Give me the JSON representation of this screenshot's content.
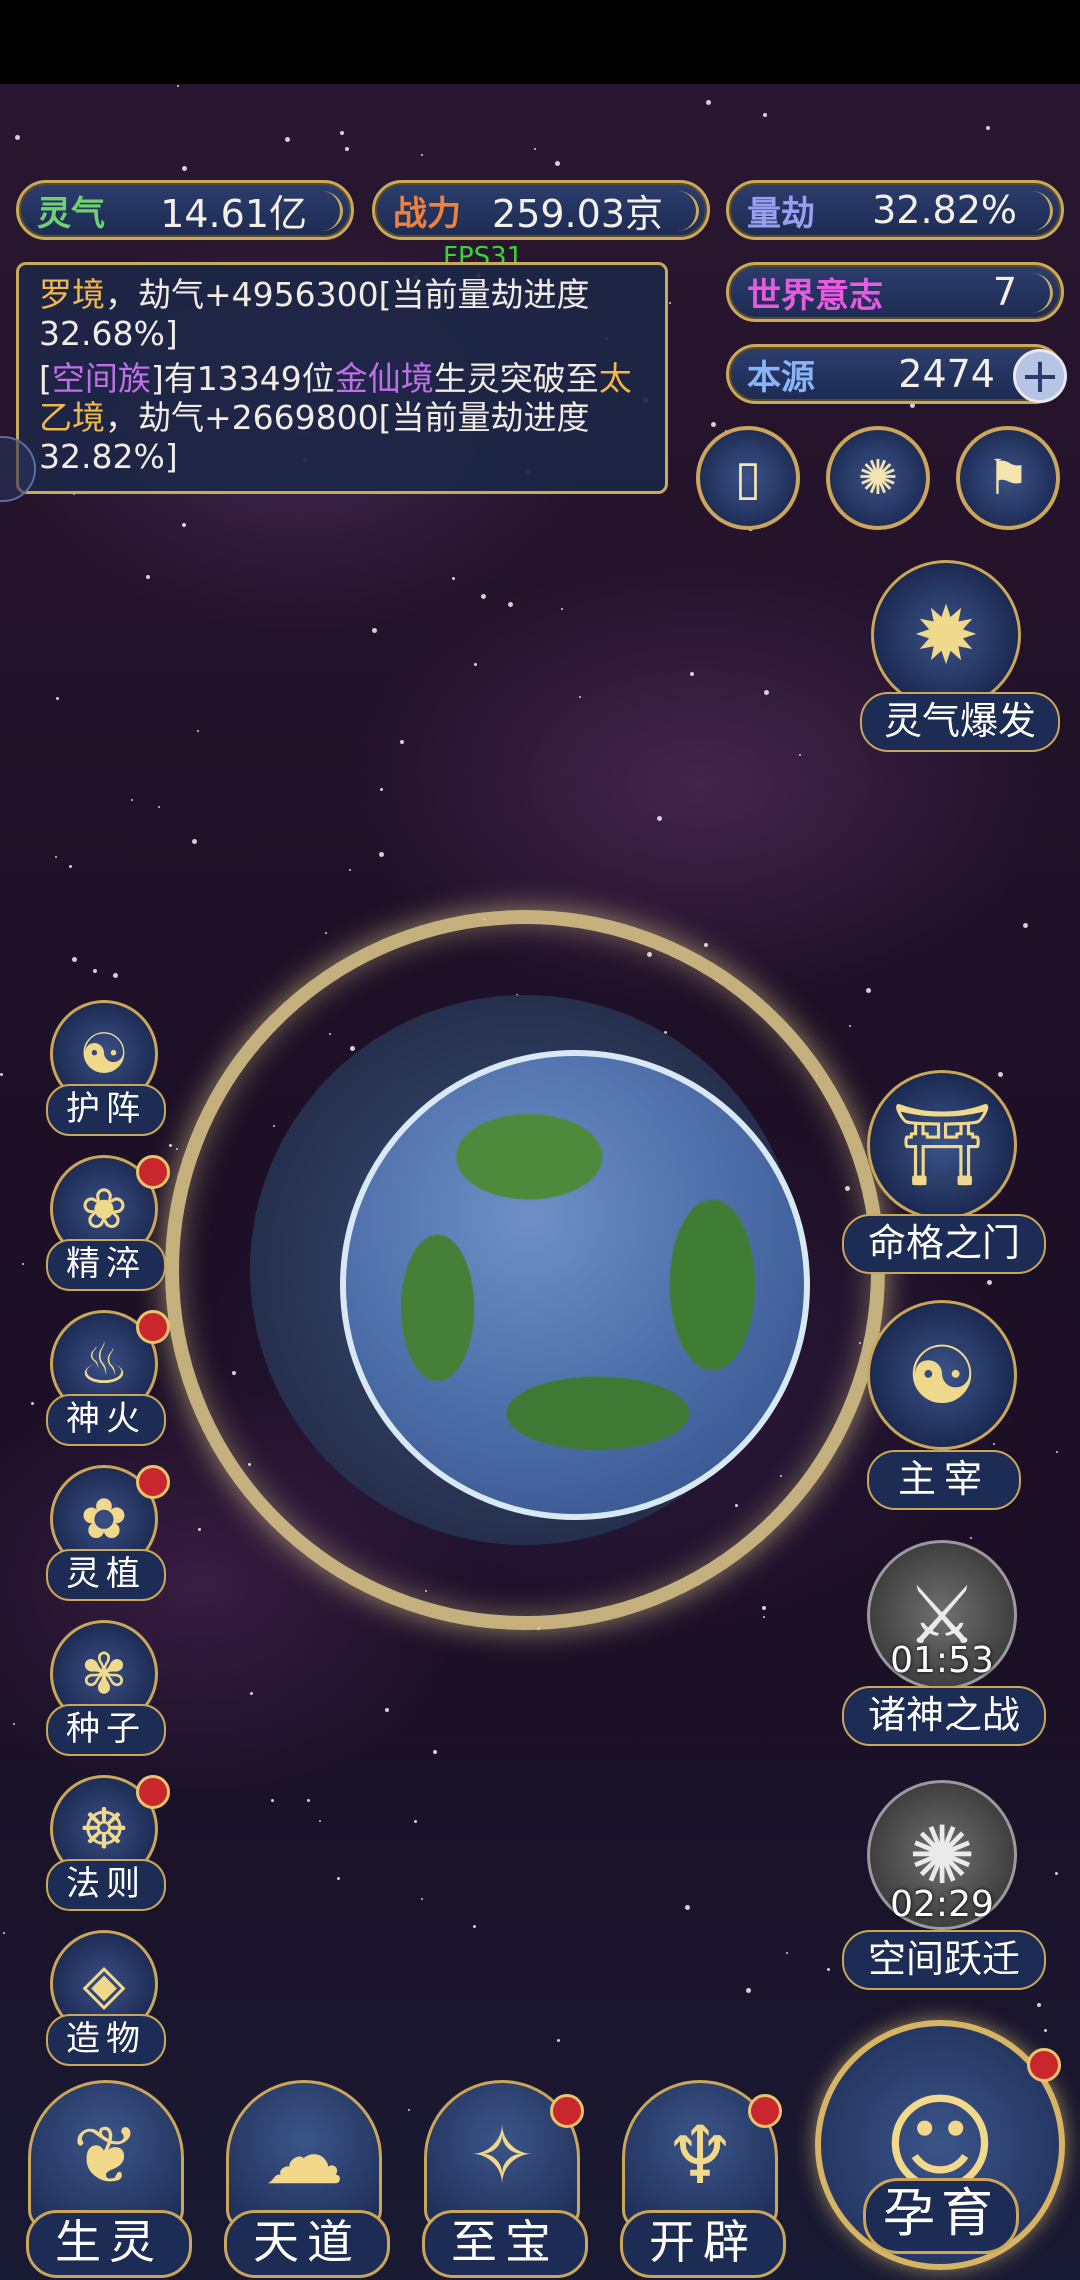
{
  "stats": {
    "lingqi": {
      "label": "灵气",
      "value": "14.61亿"
    },
    "zhanli": {
      "label": "战力",
      "value": "259.03京"
    },
    "liangjie": {
      "label": "量劫",
      "value": "32.82%"
    },
    "shijie": {
      "label": "世界意志",
      "value": "7"
    },
    "benyuan": {
      "label": "本源",
      "value": "2474"
    }
  },
  "fps": "FPS31",
  "log": {
    "entry1": {
      "realm": "罗境",
      "text": "，劫气+4956300[当前量劫进度32.68%]"
    },
    "entry2": {
      "open": "[",
      "clan": "空间族",
      "mid": "]有13349位",
      "realm1": "金仙境",
      "mid2": "生灵突破至",
      "realm2": "太乙境",
      "tail": "，劫气+2669800[当前量劫进度32.82%]"
    }
  },
  "top_icons": [
    "card-icon",
    "swirl-icon",
    "flag-icon"
  ],
  "burst": {
    "label": "灵气爆发"
  },
  "left_menu": [
    {
      "label": "护阵",
      "badge": false
    },
    {
      "label": "精淬",
      "badge": true
    },
    {
      "label": "神火",
      "badge": true
    },
    {
      "label": "灵植",
      "badge": true
    },
    {
      "label": "种子",
      "badge": false
    },
    {
      "label": "法则",
      "badge": true
    },
    {
      "label": "造物",
      "badge": false
    }
  ],
  "right_menu": {
    "fate_gate": {
      "label": "命格之门"
    },
    "ruler": {
      "label": "主宰"
    },
    "gods_war": {
      "label": "诸神之战",
      "timer": "01:53"
    },
    "space_jump": {
      "label": "空间跃迁",
      "timer": "02:29"
    }
  },
  "bottom_menu": [
    {
      "label": "生灵",
      "badge": false
    },
    {
      "label": "天道",
      "badge": false
    },
    {
      "label": "至宝",
      "badge": true
    },
    {
      "label": "开辟",
      "badge": true
    }
  ],
  "nurture": {
    "label": "孕育",
    "badge": true
  }
}
